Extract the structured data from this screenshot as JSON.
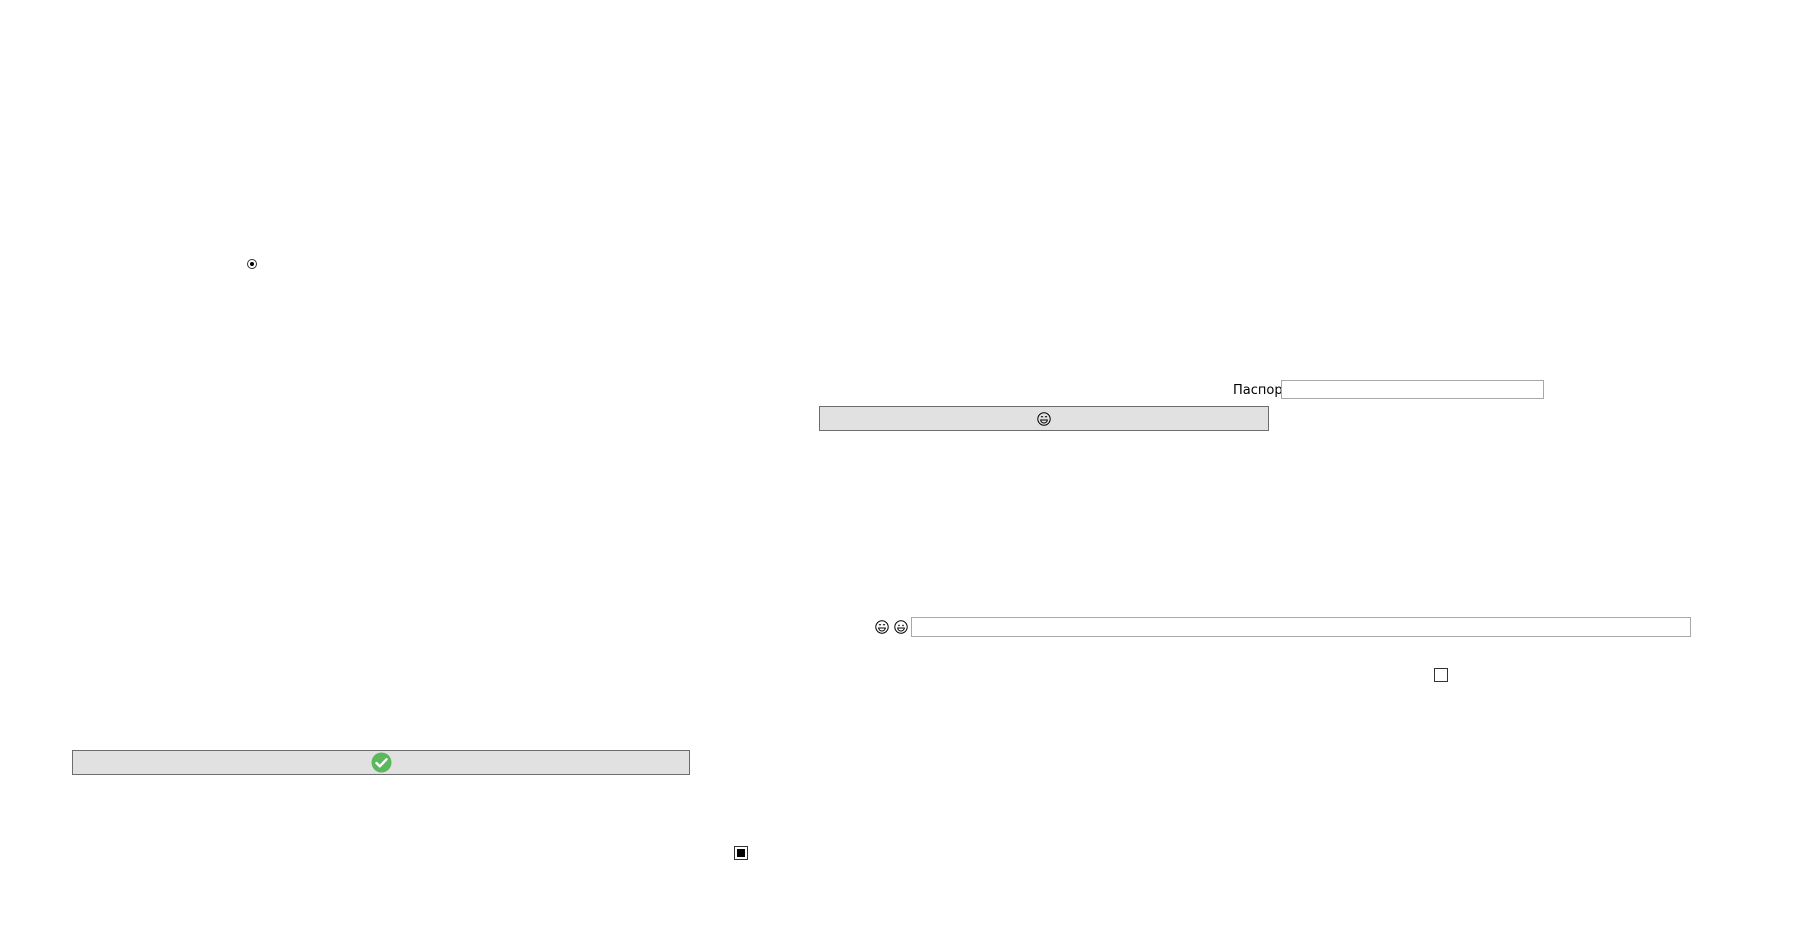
{
  "radio": {
    "selected": true,
    "icon": "radio-selected-icon"
  },
  "passport": {
    "label": "Паспорт",
    "value": "",
    "placeholder": ""
  },
  "emoji_button": {
    "icon": "grinning-face-icon"
  },
  "emoji_row": {
    "icons": [
      "grinning-face-icon",
      "grinning-face-icon"
    ],
    "input_value": "",
    "input_placeholder": ""
  },
  "check_button": {
    "icon": "check-circle-icon",
    "icon_color": "#5cb85c"
  },
  "checkboxes": [
    {
      "checked": false
    },
    {
      "checked": true
    }
  ]
}
